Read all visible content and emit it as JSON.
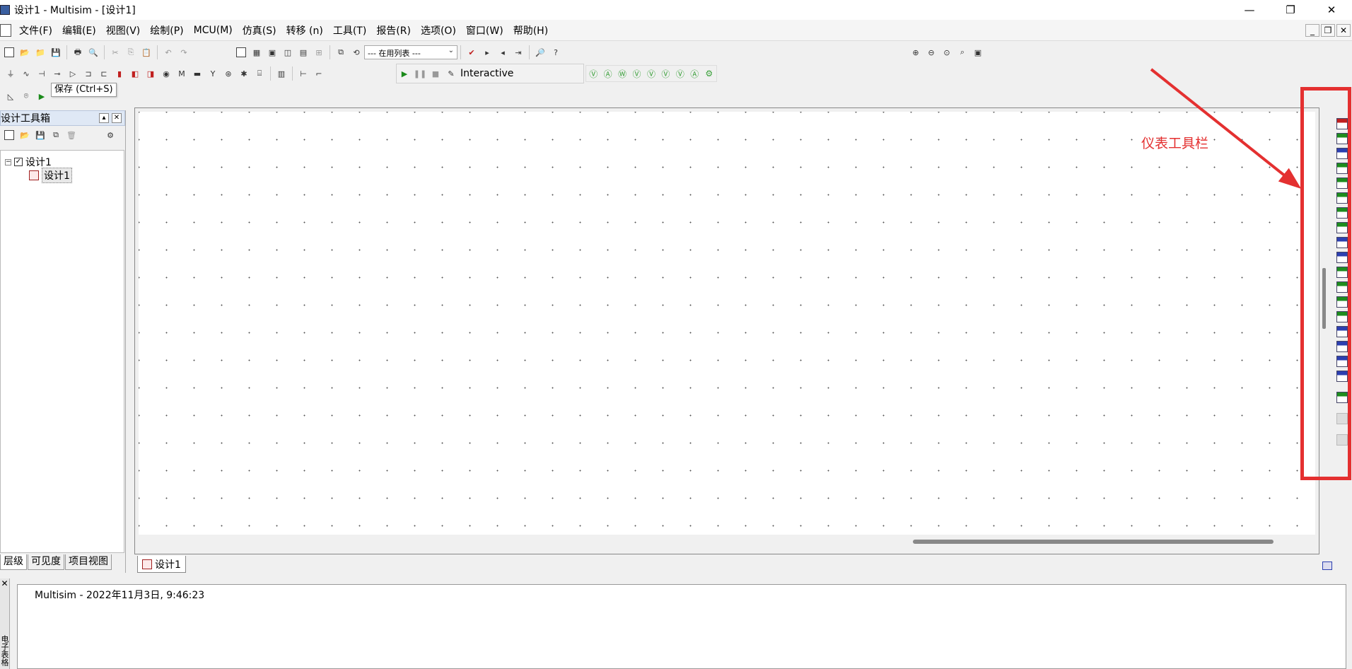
{
  "window": {
    "title": "设计1 - Multisim - [设计1]",
    "minimize": "—",
    "maximize": "❐",
    "close": "✕"
  },
  "menu": {
    "items": [
      "文件(F)",
      "编辑(E)",
      "视图(V)",
      "绘制(P)",
      "MCU(M)",
      "仿真(S)",
      "转移 (n)",
      "工具(T)",
      "报告(R)",
      "选项(O)",
      "窗口(W)",
      "帮助(H)"
    ],
    "mdi_minimize": "_",
    "mdi_restore": "❐",
    "mdi_close": "✕"
  },
  "toolbar": {
    "in_use_list": "--- 在用列表 ---",
    "tooltip": "保存 (Ctrl+S)"
  },
  "simulation": {
    "mode_label": "Interactive"
  },
  "toolbox": {
    "title": "设计工具箱",
    "tree": {
      "root": "设计1",
      "child": "设计1"
    },
    "tabs": [
      "层级",
      "可见度",
      "项目视图"
    ]
  },
  "workspace": {
    "doc_tab": "设计1"
  },
  "annotation": {
    "label": "仪表工具栏",
    "color": "#e43030"
  },
  "output": {
    "log_line": "Multisim  -  2022年11月3日, 9:46:23",
    "side_label": "电子表格视图"
  }
}
